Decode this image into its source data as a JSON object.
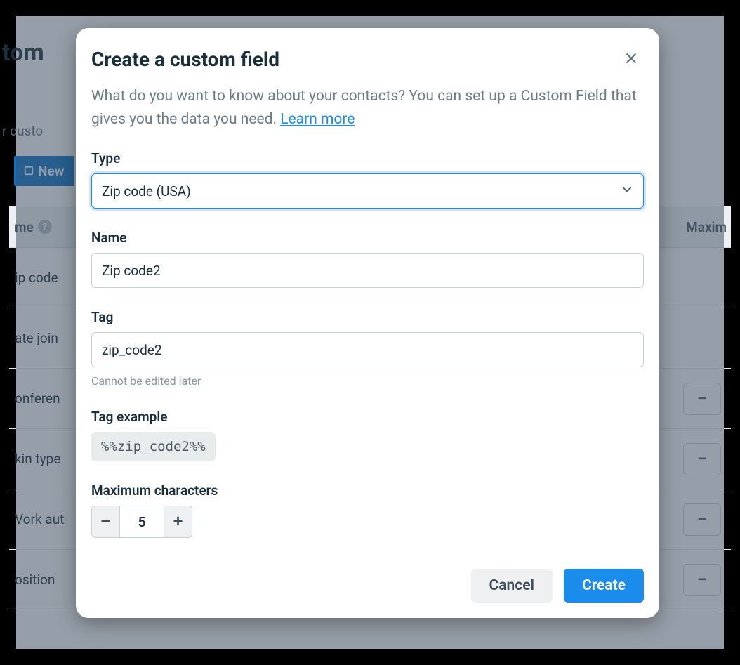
{
  "background": {
    "page_title_fragment": "tom",
    "subtitle_fragment": "r custo",
    "new_button_label": "New",
    "table": {
      "header_name": "me",
      "header_max": "Maxim",
      "rows": [
        {
          "name": "ip code",
          "show_pill": false
        },
        {
          "name": "ate join",
          "show_pill": false
        },
        {
          "name": "onferen",
          "show_pill": true
        },
        {
          "name": "kin type",
          "show_pill": true
        },
        {
          "name": "Vork aut",
          "show_pill": true
        },
        {
          "name": "osition",
          "show_pill": true
        }
      ]
    }
  },
  "modal": {
    "title": "Create a custom field",
    "intro_text": "What do you want to know about your contacts? You can set up a Custom Field that gives you the data you need. ",
    "learn_more": "Learn more",
    "type_label": "Type",
    "type_value": "Zip code (USA)",
    "name_label": "Name",
    "name_value": "Zip code2",
    "tag_label": "Tag",
    "tag_value": "zip_code2",
    "tag_help": "Cannot be edited later",
    "tag_example_label": "Tag example",
    "tag_example_value": "%%zip_code2%%",
    "maxchars_label": "Maximum characters",
    "maxchars_value": "5",
    "cancel_label": "Cancel",
    "create_label": "Create"
  }
}
